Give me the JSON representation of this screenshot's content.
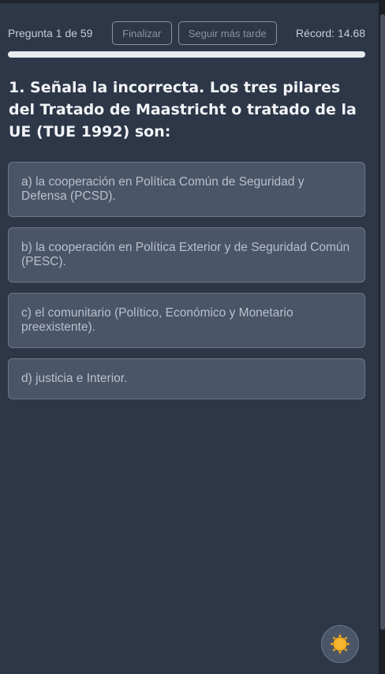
{
  "header": {
    "counter": "Pregunta 1 de 59",
    "finish_label": "Finalizar",
    "later_label": "Seguir más tarde",
    "record": "Récord: 14.68"
  },
  "progress": {
    "value": 0.0
  },
  "question": {
    "text": "1. Señala la incorrecta. Los tres pilares del Tratado de Maastricht o tratado de la UE (TUE 1992) son:"
  },
  "answers": [
    "a) la cooperación en Política Común de Seguridad y Defensa (PCSD).",
    "b) la cooperación en Política Exterior y de Seguridad Común (PESC).",
    "c) el comunitario (Político, Económico y Monetario preexistente).",
    "d) justicia e Interior."
  ],
  "theme_toggle": {
    "icon": "sun-icon",
    "sun_color": "#f6ad1a"
  }
}
